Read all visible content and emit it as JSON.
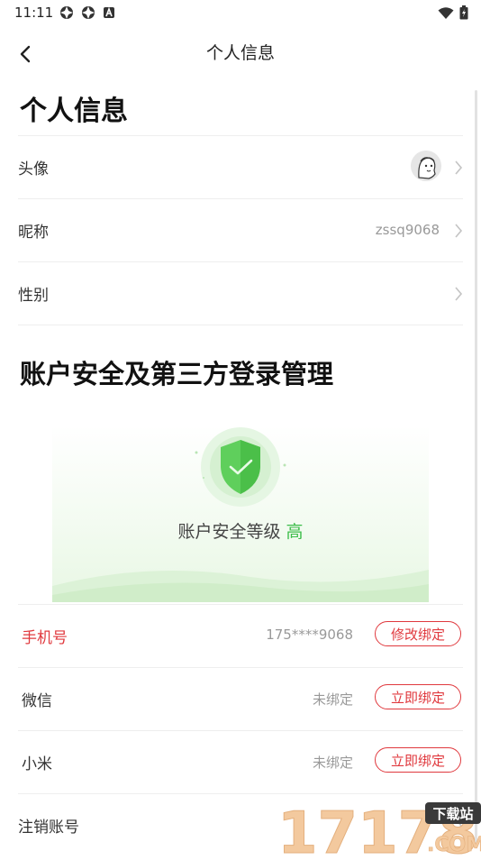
{
  "status_bar": {
    "time": "11:11"
  },
  "nav": {
    "title": "个人信息"
  },
  "personal": {
    "title": "个人信息",
    "rows": [
      {
        "label": "头像"
      },
      {
        "label": "昵称",
        "value": "zssq9068"
      },
      {
        "label": "性别"
      }
    ]
  },
  "security": {
    "title": "账户安全及第三方登录管理",
    "level_label": "账户安全等级",
    "level_value": "高"
  },
  "bindings": [
    {
      "label": "手机号",
      "status": "175****9068",
      "button": "修改绑定"
    },
    {
      "label": "微信",
      "status": "未绑定",
      "button": "立即绑定"
    },
    {
      "label": "小米",
      "status": "未绑定",
      "button": "立即绑定"
    }
  ],
  "deregister": {
    "label": "注销账号"
  },
  "watermark": {
    "digits": "17178",
    "tag": "下载站",
    "domain": ".COM"
  },
  "colors": {
    "accent_red": "#e0393e",
    "security_green": "#3dbd4a"
  }
}
